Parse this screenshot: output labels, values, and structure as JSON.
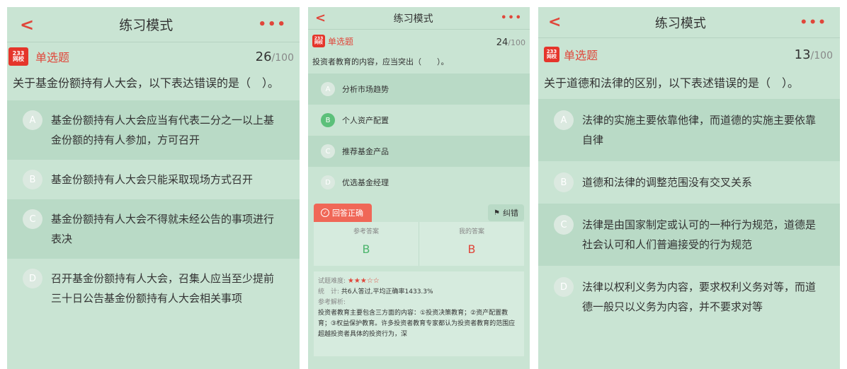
{
  "colors": {
    "accent": "#e0463a",
    "background": "#c9e4d3",
    "alt_row": "#b9dac6",
    "correct": "#5cc07a"
  },
  "panels": [
    {
      "back_icon": "chevron-left-icon",
      "title": "练习模式",
      "more": "•••",
      "logo_line1": "233",
      "logo_line2": "网校",
      "type_label": "单选题",
      "current": "26",
      "total": "/100",
      "question": "关于基金份额持有人大会，以下表达错误的是（　）。",
      "options": [
        {
          "letter": "A",
          "text": "基金份额持有人大会应当有代表二分之一以上基金份额的持有人参加，方可召开"
        },
        {
          "letter": "B",
          "text": "基金份额持有人大会只能采取现场方式召开"
        },
        {
          "letter": "C",
          "text": "基金份额持有人大会不得就未经公告的事项进行表决"
        },
        {
          "letter": "D",
          "text": "召开基金份额持有人大会，召集人应当至少提前三十日公告基金份额持有人大会相关事项"
        }
      ]
    },
    {
      "back_icon": "chevron-left-icon",
      "title": "练习模式",
      "more": "•••",
      "logo_line1": "233",
      "logo_line2": "网校",
      "type_label": "单选题",
      "current": "24",
      "total": "/100",
      "question": "投资者教育的内容，应当突出（　　）。",
      "options": [
        {
          "letter": "A",
          "text": "分析市场趋势"
        },
        {
          "letter": "B",
          "text": "个人资产配置"
        },
        {
          "letter": "C",
          "text": "推荐基金产品"
        },
        {
          "letter": "D",
          "text": "优选基金经理"
        }
      ],
      "result": {
        "correct_label": "回答正确",
        "report_label": "纠错",
        "ref_answer_label": "参考答案",
        "ref_answer": "B",
        "my_answer_label": "我的答案",
        "my_answer": "B"
      },
      "analysis": {
        "difficulty_label": "试题难度:",
        "difficulty_stars": 3,
        "stars_filled": "★★★",
        "stars_empty": "☆☆",
        "stats_label": "统　计:",
        "stats_text": "共6人答过,平均正确率1433.3%",
        "ref_label": "参考解析:",
        "text": "投资者教育主要包含三方面的内容：①投资决策教育；②资产配置教育；③权益保护教育。许多投资者教育专家都认为投资者教育的范围应超越投资者具体的投资行为，深"
      }
    },
    {
      "back_icon": "chevron-left-icon",
      "title": "练习模式",
      "more": "•••",
      "logo_line1": "233",
      "logo_line2": "网校",
      "type_label": "单选题",
      "current": "13",
      "total": "/100",
      "question": "关于道德和法律的区别，以下表述错误的是（　）。",
      "options": [
        {
          "letter": "A",
          "text": "法律的实施主要依靠他律，而道德的实施主要依靠自律"
        },
        {
          "letter": "B",
          "text": "道德和法律的调整范围没有交叉关系"
        },
        {
          "letter": "C",
          "text": "法律是由国家制定或认可的一种行为规范，道德是社会认可和人们普遍接受的行为规范"
        },
        {
          "letter": "D",
          "text": "法律以权利义务为内容，要求权利义务对等，而道德一般只以义务为内容，并不要求对等"
        }
      ]
    }
  ]
}
